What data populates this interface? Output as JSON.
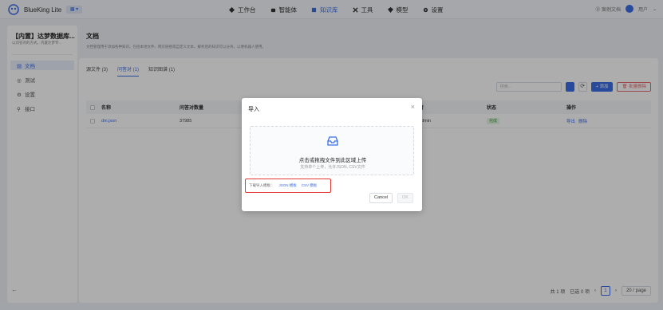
{
  "topbar": {
    "app_name": "BlueKing Lite",
    "nav": [
      {
        "label": "工作台",
        "icon": "workbench-icon",
        "active": false
      },
      {
        "label": "智能体",
        "icon": "agent-icon",
        "active": false
      },
      {
        "label": "知识库",
        "icon": "knowledge-icon",
        "active": true
      },
      {
        "label": "工具",
        "icon": "tool-icon",
        "active": false
      },
      {
        "label": "模型",
        "icon": "model-icon",
        "active": false
      },
      {
        "label": "设置",
        "icon": "settings-icon",
        "active": false
      }
    ],
    "help": "⓪ 案例文档",
    "user": "用户"
  },
  "sidebar": {
    "title": "【内置】达梦数据库...",
    "subtitle": "以问答对的方式，内置达梦专...",
    "items": [
      {
        "label": "文档",
        "active": true
      },
      {
        "label": "测试",
        "active": false
      },
      {
        "label": "设置",
        "active": false
      },
      {
        "label": "接口",
        "active": false
      }
    ],
    "back": "←"
  },
  "main": {
    "title": "文档",
    "desc": "文档管理用于添加各种知识。包括本地文件、网页链接或自定义文本，解析后的知识可以分块，以便机器人使用。",
    "tabs": [
      {
        "label": "源文件 (3)",
        "active": false
      },
      {
        "label": "问答对 (1)",
        "active": true
      },
      {
        "label": "知识图谱 (1)",
        "active": false
      }
    ],
    "search_placeholder": "搜索...",
    "refresh": "⟳",
    "add_label": "+ 添加",
    "delete_label": "🗑 批量删除"
  },
  "table": {
    "headers": [
      "名称",
      "问答对数量",
      "者",
      "状态",
      "操作"
    ],
    "rows": [
      {
        "name": "dm.json",
        "count": "37985",
        "creator": "admin",
        "status": "完成",
        "export": "导出",
        "delete": "删除"
      }
    ]
  },
  "pager": {
    "total": "共 1 项",
    "selected": "已选 0 项",
    "prev": "‹",
    "current": "1",
    "next": "›",
    "size": "20 / page"
  },
  "modal": {
    "title": "导入",
    "close": "×",
    "drop_main": "点击或拖拽文件到此区域上传",
    "drop_sub": "支持单个上传，允许JSON, CSV文件",
    "tpl_label": "下载导入模板：",
    "tpl_json": "JSON 模板",
    "tpl_csv": "CSV 模板",
    "cancel": "Cancel",
    "ok": "OK"
  },
  "colors": {
    "accent": "#3c6ee8",
    "danger": "#e53935",
    "success": "#3a9a3a"
  }
}
